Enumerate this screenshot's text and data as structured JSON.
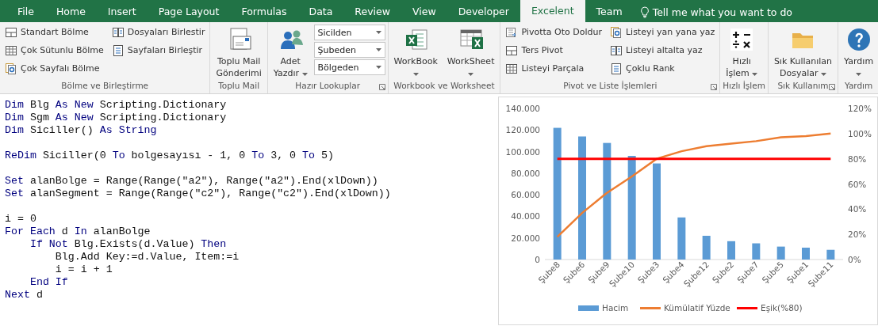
{
  "tabs": [
    {
      "label": "File",
      "selected": false
    },
    {
      "label": "Home",
      "selected": false
    },
    {
      "label": "Insert",
      "selected": false
    },
    {
      "label": "Page Layout",
      "selected": false
    },
    {
      "label": "Formulas",
      "selected": false
    },
    {
      "label": "Data",
      "selected": false
    },
    {
      "label": "Review",
      "selected": false
    },
    {
      "label": "View",
      "selected": false
    },
    {
      "label": "Developer",
      "selected": false
    },
    {
      "label": "Excelent",
      "selected": true
    },
    {
      "label": "Team",
      "selected": false
    }
  ],
  "tell_me": "Tell me what you want to do",
  "ribbon": [
    {
      "label": "Bölme ve Birleştirme",
      "launcher": false,
      "columns": [
        {
          "kind": "small",
          "items": [
            "Standart Bölme",
            "Çok Sütunlu Bölme",
            "Çok Sayfalı Bölme"
          ]
        },
        {
          "kind": "small",
          "items": [
            "Dosyaları Birlestir",
            "Sayfaları Birleştir"
          ]
        }
      ]
    },
    {
      "label": "Toplu Mail",
      "launcher": false,
      "columns": [
        {
          "kind": "large",
          "lines": [
            "Toplu Mail",
            "Gönderimi"
          ],
          "dropdown": false
        }
      ]
    },
    {
      "label": "Hazır Lookuplar",
      "launcher": true,
      "columns": [
        {
          "kind": "large",
          "lines": [
            "Adet",
            "Yazdır"
          ],
          "dropdown": true
        },
        {
          "kind": "combos",
          "items": [
            "Sicilden",
            "Şubeden",
            "Bölgeden"
          ]
        }
      ]
    },
    {
      "label": "Workbook ve Worksheet",
      "launcher": false,
      "columns": [
        {
          "kind": "large",
          "lines": [
            "WorkBook"
          ],
          "dropdown": true
        },
        {
          "kind": "large",
          "lines": [
            "WorkSheet"
          ],
          "dropdown": true
        }
      ]
    },
    {
      "label": "Pivot ve Liste İşlemleri",
      "launcher": true,
      "columns": [
        {
          "kind": "small",
          "items": [
            "Pivotta Oto Doldur",
            "Ters Pivot",
            "Listeyi Parçala"
          ]
        },
        {
          "kind": "small",
          "items": [
            "Listeyi yan yana yaz",
            "Listeyi altalta yaz",
            "Çoklu Rank"
          ]
        }
      ]
    },
    {
      "label": "Hızlı İşlem",
      "launcher": false,
      "columns": [
        {
          "kind": "large",
          "lines": [
            "Hızlı",
            "İşlem"
          ],
          "dropdown": true
        }
      ]
    },
    {
      "label": "Sık Kullanım",
      "launcher": true,
      "columns": [
        {
          "kind": "large",
          "lines": [
            "Sık Kullanılan",
            "Dosyalar"
          ],
          "dropdown": true
        }
      ]
    },
    {
      "label": "Yardım",
      "launcher": false,
      "columns": [
        {
          "kind": "large",
          "lines": [
            "Yardım"
          ],
          "dropdown": true
        }
      ]
    }
  ],
  "code": [
    {
      "segments": [
        {
          "text": "Dim",
          "keyword": true
        },
        {
          "text": " Blg",
          "keyword": false
        },
        {
          "text": " As New",
          "keyword": true
        },
        {
          "text": " Scripting.Dictionary",
          "keyword": false
        }
      ]
    },
    {
      "segments": [
        {
          "text": "Dim",
          "keyword": true
        },
        {
          "text": " Sgm",
          "keyword": false
        },
        {
          "text": " As New",
          "keyword": true
        },
        {
          "text": " Scripting.Dictionary",
          "keyword": false
        }
      ]
    },
    {
      "segments": [
        {
          "text": "Dim",
          "keyword": true
        },
        {
          "text": " Siciller()",
          "keyword": false
        },
        {
          "text": " As String",
          "keyword": true
        }
      ]
    },
    {
      "kind": "blank"
    },
    {
      "segments": [
        {
          "text": "ReDim",
          "keyword": true
        },
        {
          "text": " Siciller(0",
          "keyword": false
        },
        {
          "text": " To",
          "keyword": true
        },
        {
          "text": " bolgesayısı - 1, 0",
          "keyword": false
        },
        {
          "text": " To",
          "keyword": true
        },
        {
          "text": " 3, 0",
          "keyword": false
        },
        {
          "text": " To",
          "keyword": true
        },
        {
          "text": " 5)",
          "keyword": false
        }
      ]
    },
    {
      "kind": "blank"
    },
    {
      "segments": [
        {
          "text": "Set",
          "keyword": true
        },
        {
          "text": " alanBolge = Range(Range(\"a2\"), Range(\"a2\").End(xlDown))",
          "keyword": false
        }
      ]
    },
    {
      "segments": [
        {
          "text": "Set",
          "keyword": true
        },
        {
          "text": " alanSegment = Range(Range(\"c2\"), Range(\"c2\").End(xlDown))",
          "keyword": false
        }
      ]
    },
    {
      "kind": "blank"
    },
    {
      "segments": [
        {
          "text": "i = 0",
          "keyword": false
        }
      ]
    },
    {
      "segments": [
        {
          "text": "For Each",
          "keyword": true
        },
        {
          "text": " d",
          "keyword": false
        },
        {
          "text": " In",
          "keyword": true
        },
        {
          "text": " alanBolge",
          "keyword": false
        }
      ]
    },
    {
      "segments": [
        {
          "text": "    If Not",
          "keyword": true
        },
        {
          "text": " Blg.Exists(d.Value)",
          "keyword": false
        },
        {
          "text": " Then",
          "keyword": true
        }
      ]
    },
    {
      "segments": [
        {
          "text": "        Blg.Add Key:=d.Value, Item:=i",
          "keyword": false
        }
      ]
    },
    {
      "segments": [
        {
          "text": "        i = i + 1",
          "keyword": false
        }
      ]
    },
    {
      "segments": [
        {
          "text": "    End If",
          "keyword": true
        }
      ]
    },
    {
      "segments": [
        {
          "text": "Next",
          "keyword": true
        },
        {
          "text": " d",
          "keyword": false
        }
      ]
    }
  ],
  "chart_data": {
    "type": "bar",
    "legend": "bottom",
    "categories": [
      "Şube8",
      "Şube6",
      "Şube9",
      "Şube10",
      "Şube3",
      "Şube4",
      "Şube12",
      "Şube2",
      "Şube7",
      "Şube5",
      "Şube1",
      "Şube11"
    ],
    "ylim": [
      0,
      140000
    ],
    "yticks": [
      {
        "value": 0,
        "label": "0"
      },
      {
        "value": 20000,
        "label": "20.000"
      },
      {
        "value": 40000,
        "label": "40.000"
      },
      {
        "value": 60000,
        "label": "60.000"
      },
      {
        "value": 80000,
        "label": "80.000"
      },
      {
        "value": 100000,
        "label": "100.000"
      },
      {
        "value": 120000,
        "label": "120.000"
      },
      {
        "value": 140000,
        "label": "140.000"
      }
    ],
    "y2lim": [
      0,
      1.2
    ],
    "y2ticks": [
      {
        "value": 0,
        "label": "0%"
      },
      {
        "value": 0.2,
        "label": "20%"
      },
      {
        "value": 0.4,
        "label": "40%"
      },
      {
        "value": 0.6,
        "label": "60%"
      },
      {
        "value": 0.8,
        "label": "80%"
      },
      {
        "value": 1.0,
        "label": "100%"
      },
      {
        "value": 1.2,
        "label": "120%"
      }
    ],
    "series": [
      {
        "name": "Hacim",
        "color": "#5b9bd5",
        "values": [
          122000,
          114000,
          108000,
          96000,
          89000,
          39000,
          22000,
          17000,
          15000,
          12000,
          11000,
          9000
        ]
      },
      {
        "name": "Kümülatif Yüzde",
        "color": "#ed7d31",
        "type": "line",
        "axis": "y2",
        "values": [
          0.18,
          0.37,
          0.53,
          0.66,
          0.8,
          0.86,
          0.9,
          0.92,
          0.94,
          0.97,
          0.98,
          1.0
        ]
      },
      {
        "name": "Eşik(%80)",
        "color": "#ff0000",
        "type": "line",
        "axis": "y2",
        "values": [
          0.8,
          0.8,
          0.8,
          0.8,
          0.8,
          0.8,
          0.8,
          0.8,
          0.8,
          0.8,
          0.8,
          0.8
        ]
      }
    ]
  }
}
